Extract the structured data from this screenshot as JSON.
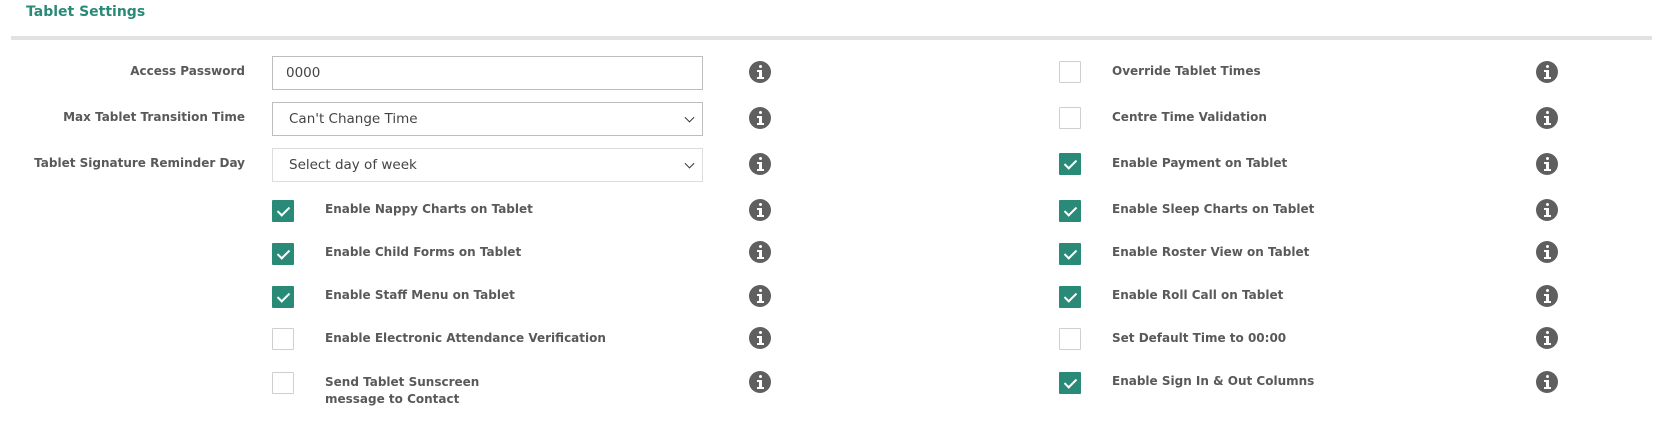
{
  "section": {
    "title": "Tablet Settings"
  },
  "left_fields": {
    "access_password": {
      "label": "Access Password",
      "value": "0000"
    },
    "max_transition": {
      "label": "Max Tablet Transition Time",
      "value": "Can't Change Time"
    },
    "signature_day": {
      "label": "Tablet Signature Reminder Day",
      "value": "Select day of week"
    }
  },
  "left_checks": [
    {
      "label": "Enable Nappy Charts on Tablet",
      "checked": true
    },
    {
      "label": "Enable Child Forms on Tablet",
      "checked": true
    },
    {
      "label": "Enable Staff Menu on Tablet",
      "checked": true
    },
    {
      "label": "Enable Electronic Attendance Verification",
      "checked": false
    },
    {
      "label_line1": "Send Tablet Sunscreen",
      "label_line2": "message to Contact",
      "checked": false
    }
  ],
  "right_checks": [
    {
      "label": "Override Tablet Times",
      "checked": false
    },
    {
      "label": "Centre Time Validation",
      "checked": false
    },
    {
      "label": "Enable Payment on Tablet",
      "checked": true
    },
    {
      "label": "Enable Sleep Charts on Tablet",
      "checked": true
    },
    {
      "label": "Enable Roster View on Tablet",
      "checked": true
    },
    {
      "label": "Enable Roll Call on Tablet",
      "checked": true
    },
    {
      "label": "Set Default Time to 00:00",
      "checked": false
    },
    {
      "label": "Enable Sign In & Out Columns",
      "checked": true
    }
  ],
  "icons": {
    "info": "info-circle-icon",
    "check": "check-icon",
    "dropdown": "chevron-down-icon"
  },
  "colors": {
    "accent": "#2a8a78",
    "icon": "#5f5f5f",
    "rule": "#e2e2e2"
  }
}
